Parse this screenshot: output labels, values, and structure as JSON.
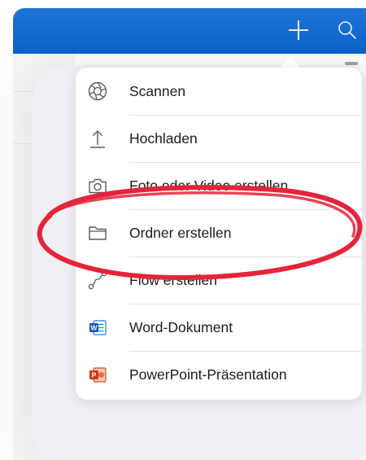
{
  "header": {
    "add_icon": "plus-icon",
    "search_icon": "search-icon"
  },
  "menu": {
    "items": [
      {
        "label": "Scannen",
        "icon": "camera-aperture-icon"
      },
      {
        "label": "Hochladen",
        "icon": "upload-arrow-icon"
      },
      {
        "label": "Foto oder Video erstellen",
        "icon": "camera-icon"
      },
      {
        "label": "Ordner erstellen",
        "icon": "folder-icon"
      },
      {
        "label": "Flow erstellen",
        "icon": "flow-icon"
      },
      {
        "label": "Word-Dokument",
        "icon": "word-document-icon"
      },
      {
        "label": "PowerPoint-Präsentation",
        "icon": "powerpoint-icon"
      }
    ]
  },
  "colors": {
    "header_blue": "#0b62c8",
    "highlight_red": "#e3243a",
    "word_blue": "#185abd",
    "powerpoint_red": "#c43e1c"
  }
}
